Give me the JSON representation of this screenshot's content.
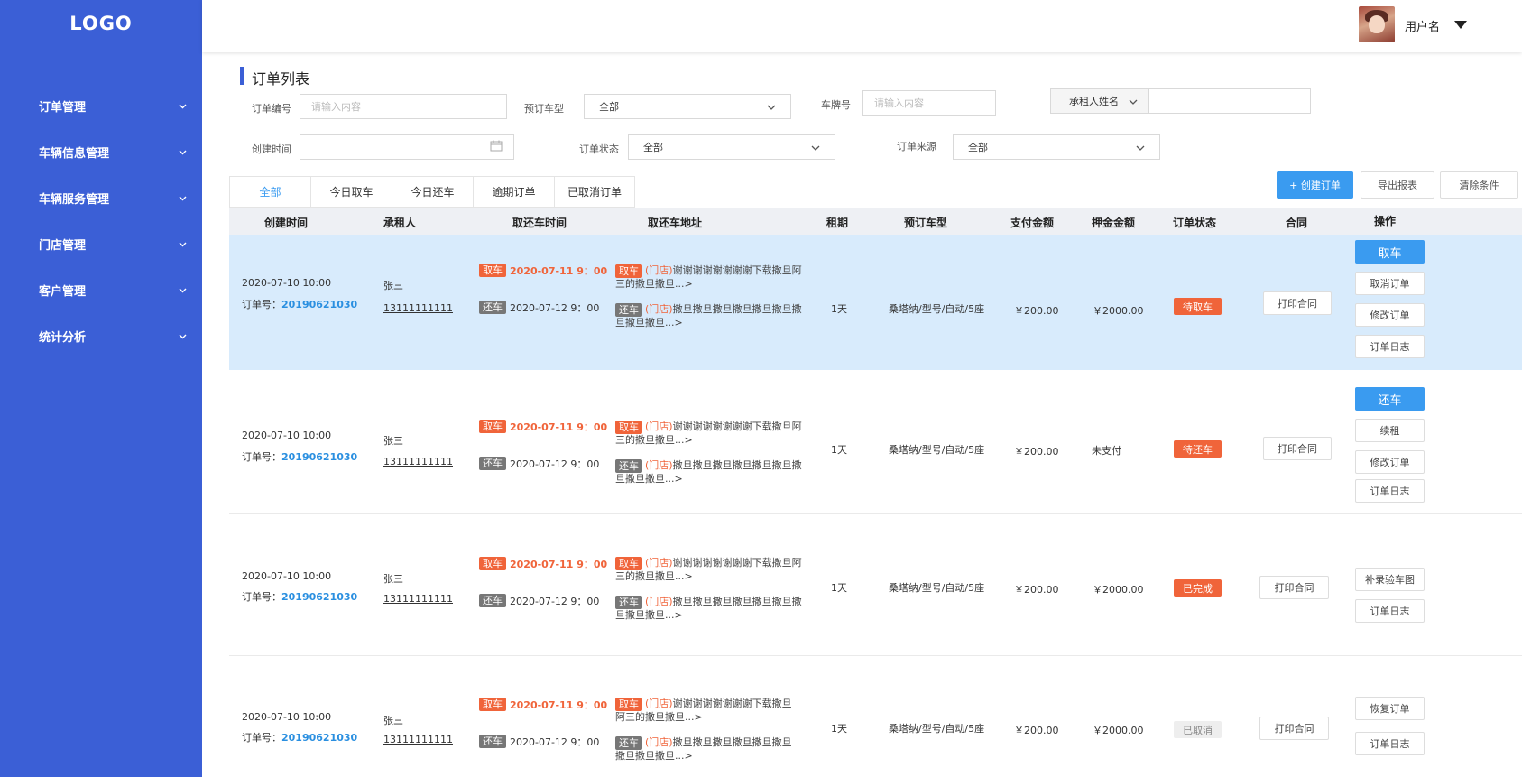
{
  "sidebar": {
    "logo": "LOGO",
    "items": [
      {
        "label": "订单管理"
      },
      {
        "label": "车辆信息管理"
      },
      {
        "label": "车辆服务管理"
      },
      {
        "label": "门店管理"
      },
      {
        "label": "客户管理"
      },
      {
        "label": "统计分析"
      }
    ]
  },
  "header": {
    "username": "用户名"
  },
  "page": {
    "title": "订单列表"
  },
  "filters": {
    "order_no": {
      "label": "订单编号",
      "placeholder": "请输入内容"
    },
    "car_type": {
      "label": "预订车型",
      "value": "全部"
    },
    "plate": {
      "label": "车牌号",
      "placeholder": "请输入内容"
    },
    "renter_select": {
      "value": "承租人姓名"
    },
    "created": {
      "label": "创建时间"
    },
    "status": {
      "label": "订单状态",
      "value": "全部"
    },
    "source": {
      "label": "订单来源",
      "value": "全部"
    }
  },
  "tabs": [
    "全部",
    "今日取车",
    "今日还车",
    "逾期订单",
    "已取消订单"
  ],
  "actions": {
    "create": "+ 创建订单",
    "export": "导出报表",
    "clear": "清除条件"
  },
  "columns": [
    "创建时间",
    "承租人",
    "取还车时间",
    "取还车地址",
    "租期",
    "预订车型",
    "支付金额",
    "押金金额",
    "订单状态",
    "合同",
    "操作"
  ],
  "rows": [
    {
      "created": "2020-07-10 10:00",
      "order_label": "订单号：",
      "order_no": "20190621030",
      "renter": "张三",
      "phone": "13111111111",
      "pick_tag": "取车",
      "pick_time": "2020-07-11 9：00",
      "return_tag": "还车",
      "return_time": "2020-07-12 9：00",
      "pick_store": "(门店)",
      "pick_addr": "谢谢谢谢谢谢谢谢下载撒旦阿三的撒旦撒旦...>",
      "return_store": "(门店)",
      "return_addr": "撒旦撒旦撒旦撒旦撒旦撒旦撒旦撒旦撒旦...>",
      "period": "1天",
      "car": "桑塔纳/型号/自动/5座",
      "pay": "￥200.00",
      "deposit": "￥2000.00",
      "status": "待取车",
      "contract": "打印合同",
      "ops": [
        "取车",
        "取消订单",
        "修改订单",
        "订单日志"
      ]
    },
    {
      "created": "2020-07-10 10:00",
      "order_label": "订单号：",
      "order_no": "20190621030",
      "renter": "张三",
      "phone": "13111111111",
      "pick_tag": "取车",
      "pick_time": "2020-07-11 9：00",
      "return_tag": "还车",
      "return_time": "2020-07-12 9：00",
      "pick_store": "(门店)",
      "pick_addr": "谢谢谢谢谢谢谢谢下载撒旦阿三的撒旦撒旦...>",
      "return_store": "(门店)",
      "return_addr": "撒旦撒旦撒旦撒旦撒旦撒旦撒旦撒旦撒旦...>",
      "period": "1天",
      "car": "桑塔纳/型号/自动/5座",
      "pay": "￥200.00",
      "deposit": "未支付",
      "status": "待还车",
      "contract": "打印合同",
      "ops": [
        "还车",
        "续租",
        "修改订单",
        "订单日志"
      ]
    },
    {
      "created": "2020-07-10 10:00",
      "order_label": "订单号：",
      "order_no": "20190621030",
      "renter": "张三",
      "phone": "13111111111",
      "pick_tag": "取车",
      "pick_time": "2020-07-11 9：00",
      "return_tag": "还车",
      "return_time": "2020-07-12 9：00",
      "pick_store": "(门店)",
      "pick_addr": "谢谢谢谢谢谢谢谢下载撒旦阿三的撒旦撒旦...>",
      "return_store": "(门店)",
      "return_addr": "撒旦撒旦撒旦撒旦撒旦撒旦撒旦撒旦撒旦...>",
      "period": "1天",
      "car": "桑塔纳/型号/自动/5座",
      "pay": "￥200.00",
      "deposit": "￥2000.00",
      "status": "已完成",
      "contract": "打印合同",
      "ops": [
        "补录验车图",
        "订单日志"
      ]
    },
    {
      "created": "2020-07-10 10:00",
      "order_label": "订单号：",
      "order_no": "20190621030",
      "renter": "张三",
      "phone": "13111111111",
      "pick_tag": "取车",
      "pick_time": "2020-07-11 9：00",
      "return_tag": "还车",
      "return_time": "2020-07-12 9：00",
      "pick_store": "(门店)",
      "pick_addr": "谢谢谢谢谢谢谢谢下载撒旦阿三的撒旦撒旦...>",
      "return_store": "(门店)",
      "return_addr": "撒旦撒旦撒旦撒旦撒旦撒旦撒旦撒旦撒旦...>",
      "period": "1天",
      "car": "桑塔纳/型号/自动/5座",
      "pay": "￥200.00",
      "deposit": "￥2000.00",
      "status": "已取消",
      "contract": "打印合同",
      "ops": [
        "恢复订单",
        "订单日志"
      ]
    }
  ],
  "colors": {
    "sidebar": "#3b5fd6",
    "primary": "#3a9bf0",
    "accent": "#f0643a",
    "highlight_row": "#d8ebfc"
  }
}
